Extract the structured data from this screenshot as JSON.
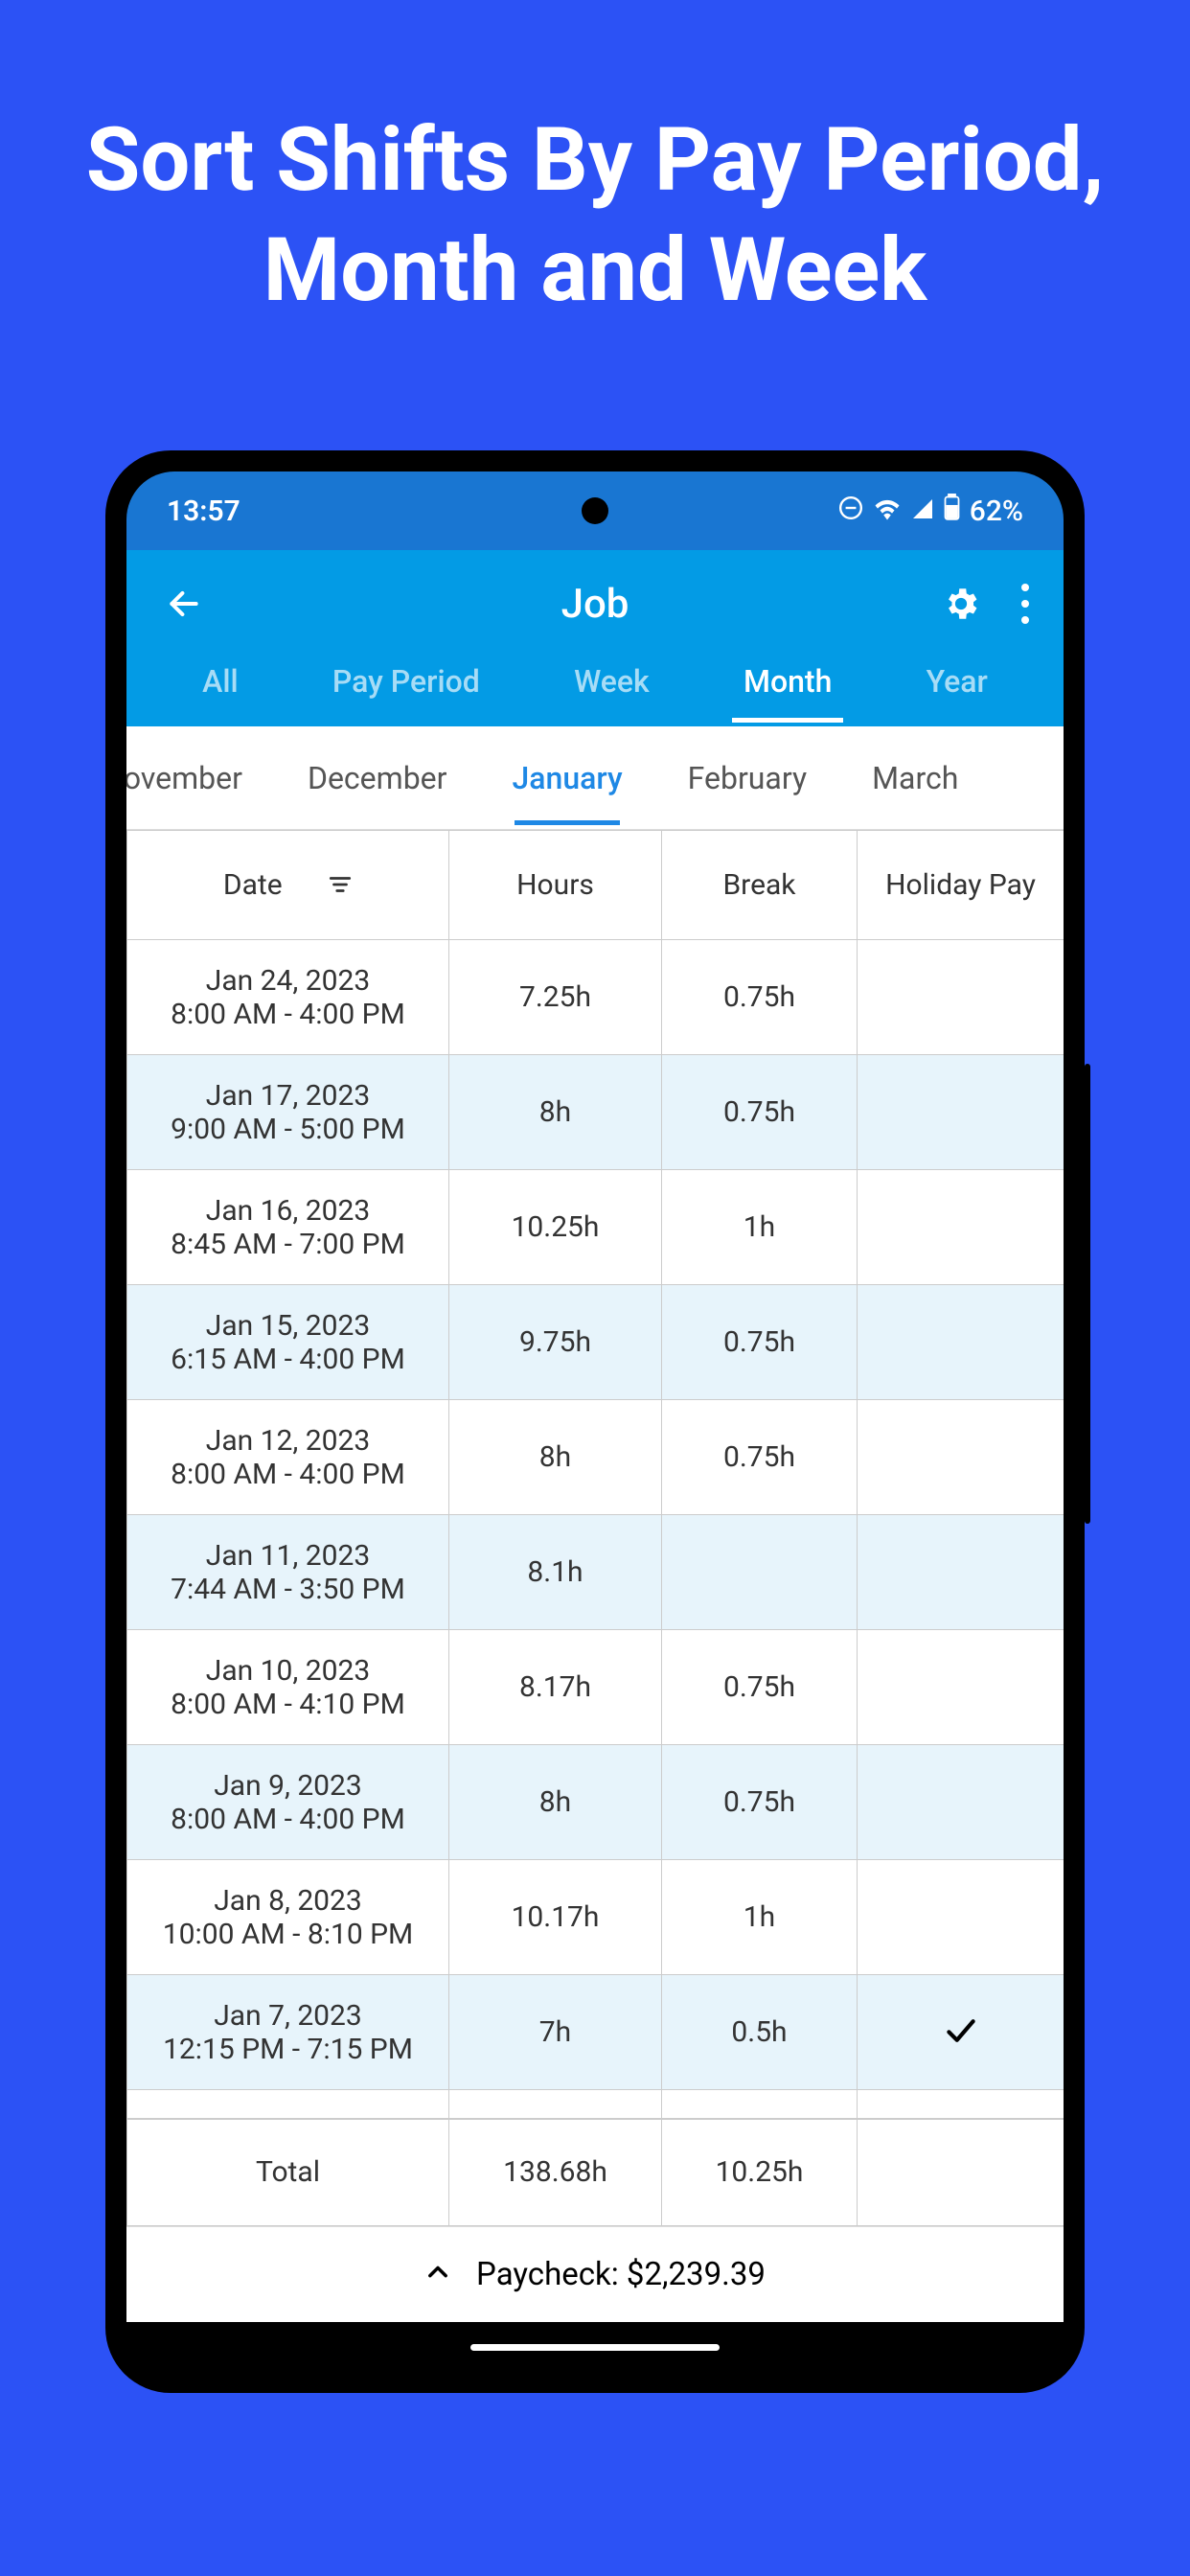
{
  "headline": "Sort Shifts By Pay Period, Month and Week",
  "status": {
    "time": "13:57",
    "battery": "62%"
  },
  "appbar": {
    "title": "Job"
  },
  "periods": {
    "items": [
      "All",
      "Pay Period",
      "Week",
      "Month",
      "Year"
    ],
    "active": "Month"
  },
  "months": {
    "items": [
      "November",
      "December",
      "January",
      "February",
      "March"
    ],
    "active": "January"
  },
  "columns": {
    "date": "Date",
    "hours": "Hours",
    "break": "Break",
    "holiday": "Holiday Pay"
  },
  "rows": [
    {
      "date": "Jan 24, 2023",
      "times": "8:00 AM - 4:00 PM",
      "hours": "7.25h",
      "break": "0.75h",
      "holiday": ""
    },
    {
      "date": "Jan 17, 2023",
      "times": "9:00 AM - 5:00 PM",
      "hours": "8h",
      "break": "0.75h",
      "holiday": ""
    },
    {
      "date": "Jan 16, 2023",
      "times": "8:45 AM - 7:00 PM",
      "hours": "10.25h",
      "break": "1h",
      "holiday": ""
    },
    {
      "date": "Jan 15, 2023",
      "times": "6:15 AM - 4:00 PM",
      "hours": "9.75h",
      "break": "0.75h",
      "holiday": ""
    },
    {
      "date": "Jan 12, 2023",
      "times": "8:00 AM - 4:00 PM",
      "hours": "8h",
      "break": "0.75h",
      "holiday": ""
    },
    {
      "date": "Jan 11, 2023",
      "times": "7:44 AM - 3:50 PM",
      "hours": "8.1h",
      "break": "",
      "holiday": ""
    },
    {
      "date": "Jan 10, 2023",
      "times": "8:00 AM - 4:10 PM",
      "hours": "8.17h",
      "break": "0.75h",
      "holiday": ""
    },
    {
      "date": "Jan 9, 2023",
      "times": "8:00 AM - 4:00 PM",
      "hours": "8h",
      "break": "0.75h",
      "holiday": ""
    },
    {
      "date": "Jan 8, 2023",
      "times": "10:00 AM - 8:10 PM",
      "hours": "10.17h",
      "break": "1h",
      "holiday": ""
    },
    {
      "date": "Jan 7, 2023",
      "times": "12:15 PM - 7:15 PM",
      "hours": "7h",
      "break": "0.5h",
      "holiday": "check"
    }
  ],
  "totals": {
    "label": "Total",
    "hours": "138.68h",
    "break": "10.25h"
  },
  "paycheck": {
    "label": "Paycheck: $2,239.39"
  }
}
